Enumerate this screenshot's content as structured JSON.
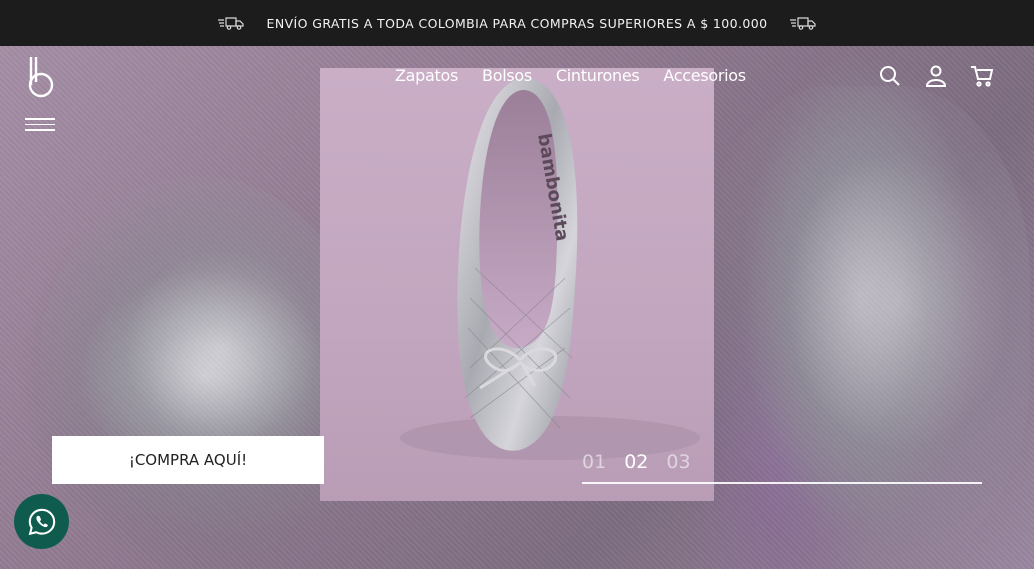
{
  "announcement": {
    "text": "ENVÍO GRATIS A TODA COLOMBIA PARA COMPRAS SUPERIORES A $ 100.000",
    "icon_left": "delivery-truck-icon",
    "icon_right": "delivery-truck-icon"
  },
  "header": {
    "logo_icon": "brand-b-logo",
    "menu_icon": "hamburger-menu-icon",
    "nav": [
      {
        "label": "Zapatos"
      },
      {
        "label": "Bolsos"
      },
      {
        "label": "Cinturones"
      },
      {
        "label": "Accesorios"
      }
    ],
    "icons": [
      "search-icon",
      "user-icon",
      "cart-icon"
    ]
  },
  "hero": {
    "cta_label": "¡COMPRA AQUÍ!",
    "slides": [
      {
        "label": "01",
        "active": false
      },
      {
        "label": "02",
        "active": true
      },
      {
        "label": "03",
        "active": false
      }
    ],
    "product_print": "bambonita"
  },
  "colors": {
    "topbar_bg": "#1c1c1c",
    "panel_bg": "#c2a6bf",
    "whatsapp_bg": "#0f5c4f",
    "text_light": "#ffffff"
  },
  "whatsapp": {
    "icon": "whatsapp-icon"
  }
}
